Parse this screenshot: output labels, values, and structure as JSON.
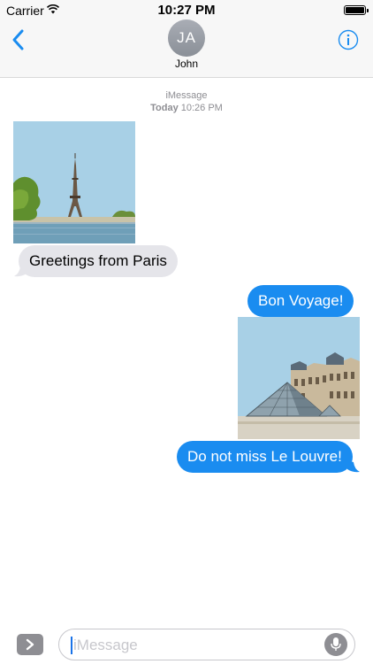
{
  "status_bar": {
    "carrier": "Carrier",
    "time": "10:27 PM"
  },
  "header": {
    "avatar_initials": "JA",
    "contact_name": "John"
  },
  "timestamp": {
    "service": "iMessage",
    "day": "Today",
    "time": "10:26 PM"
  },
  "messages": [
    {
      "type": "image",
      "direction": "incoming",
      "icon": "eiffel-tower-sticker"
    },
    {
      "type": "text",
      "direction": "incoming",
      "text": "Greetings from Paris"
    },
    {
      "type": "text",
      "direction": "outgoing",
      "text": "Bon Voyage!"
    },
    {
      "type": "image",
      "direction": "outgoing",
      "icon": "louvre-pyramid-sticker"
    },
    {
      "type": "text",
      "direction": "outgoing",
      "text": "Do not miss Le Louvre!"
    }
  ],
  "composer": {
    "placeholder": "iMessage"
  },
  "colors": {
    "accent": "#1a8cf0",
    "incoming_bubble": "#e5e5ea",
    "nav_background": "#f7f7f7"
  }
}
